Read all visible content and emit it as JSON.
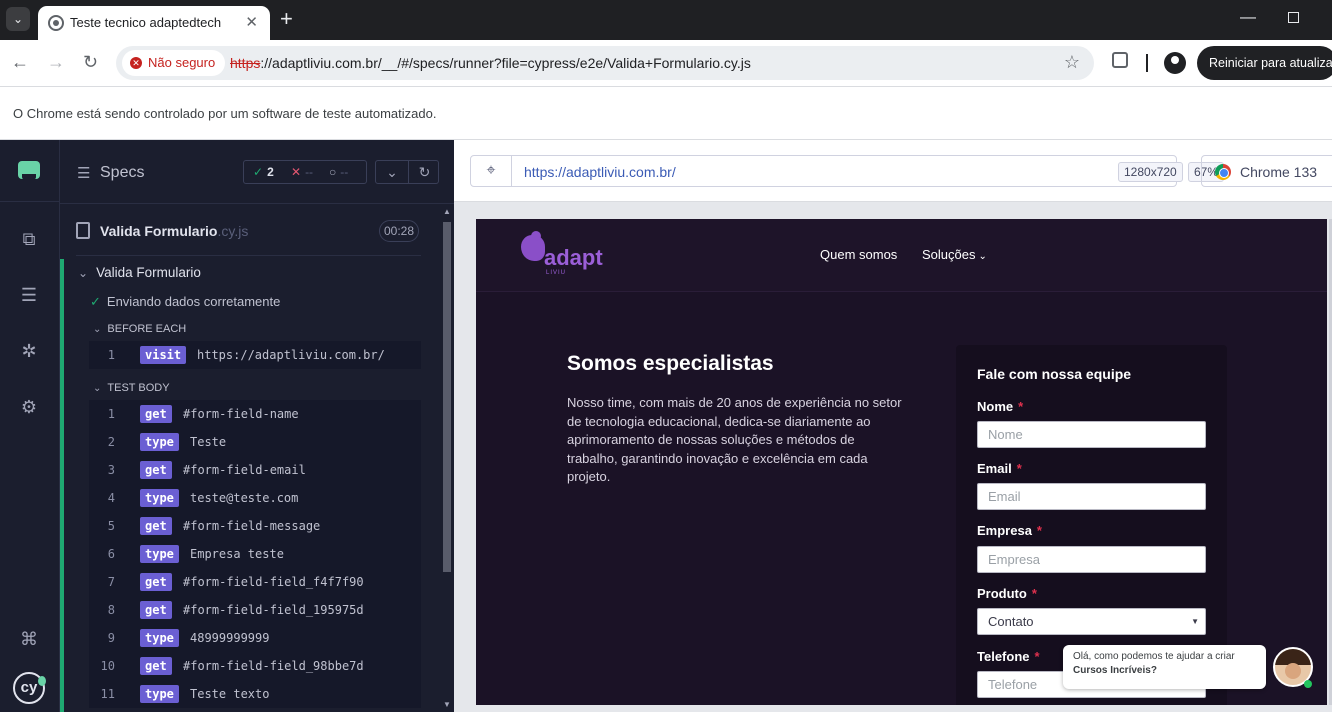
{
  "browser": {
    "tab_title": "Teste tecnico adaptedtech",
    "new_tab": "+",
    "security_label": "Não seguro",
    "url_scheme": "https",
    "url_rest": "://adaptliviu.com.br/__/#/specs/runner?file=cypress/e2e/Valida+Formulario.cy.js",
    "update_button": "Reiniciar para atualizar",
    "infobar_text": "O Chrome está sendo controlado por um software de teste automatizado."
  },
  "specs": {
    "title": "Specs",
    "passed": "2",
    "failed": "--",
    "pending": "--",
    "file_name": "Valida Formulario",
    "file_ext": ".cy.js",
    "duration": "00:28",
    "suite": "Valida Formulario",
    "test": "Enviando dados corretamente",
    "before_each_label": "BEFORE EACH",
    "test_body_label": "TEST BODY",
    "before_each": [
      {
        "num": "1",
        "name": "visit",
        "arg": "https://adaptliviu.com.br/"
      }
    ],
    "commands": [
      {
        "num": "1",
        "name": "get",
        "arg": "#form-field-name"
      },
      {
        "num": "2",
        "name": "type",
        "arg": "Teste"
      },
      {
        "num": "3",
        "name": "get",
        "arg": "#form-field-email"
      },
      {
        "num": "4",
        "name": "type",
        "arg": "teste@teste.com"
      },
      {
        "num": "5",
        "name": "get",
        "arg": "#form-field-message"
      },
      {
        "num": "6",
        "name": "type",
        "arg": "Empresa teste"
      },
      {
        "num": "7",
        "name": "get",
        "arg": "#form-field-field_f4f7f90"
      },
      {
        "num": "8",
        "name": "get",
        "arg": "#form-field-field_195975d"
      },
      {
        "num": "9",
        "name": "type",
        "arg": "48999999999"
      },
      {
        "num": "10",
        "name": "get",
        "arg": "#form-field-field_98bbe7d"
      },
      {
        "num": "11",
        "name": "type",
        "arg": "Teste texto"
      }
    ]
  },
  "aut": {
    "url": "https://adaptliviu.com.br/",
    "viewport": "1280x720",
    "zoom": "67%",
    "browser": "Chrome 133"
  },
  "site": {
    "logo": "adapt",
    "logo_sub": "LIVIU",
    "menu": [
      "Quem somos",
      "Soluções"
    ],
    "hero_title": "Somos especialistas",
    "hero_text": "Nosso time, com mais de 20 anos de experiência no setor de tecnologia educacional, dedica-se diariamente ao aprimoramento de nossas soluções e métodos de trabalho, garantindo inovação e excelência em cada projeto.",
    "form_title": "Fale com nossa equipe",
    "required_mark": "*",
    "fields": [
      {
        "label": "Nome",
        "placeholder": "Nome"
      },
      {
        "label": "Email",
        "placeholder": "Email"
      },
      {
        "label": "Empresa",
        "placeholder": "Empresa"
      },
      {
        "label": "Produto",
        "value": "Contato"
      },
      {
        "label": "Telefone",
        "placeholder": "Telefone"
      }
    ],
    "chat_line1": "Olá, como podemos te ajudar a criar",
    "chat_line2": "Cursos Incríveis?"
  }
}
